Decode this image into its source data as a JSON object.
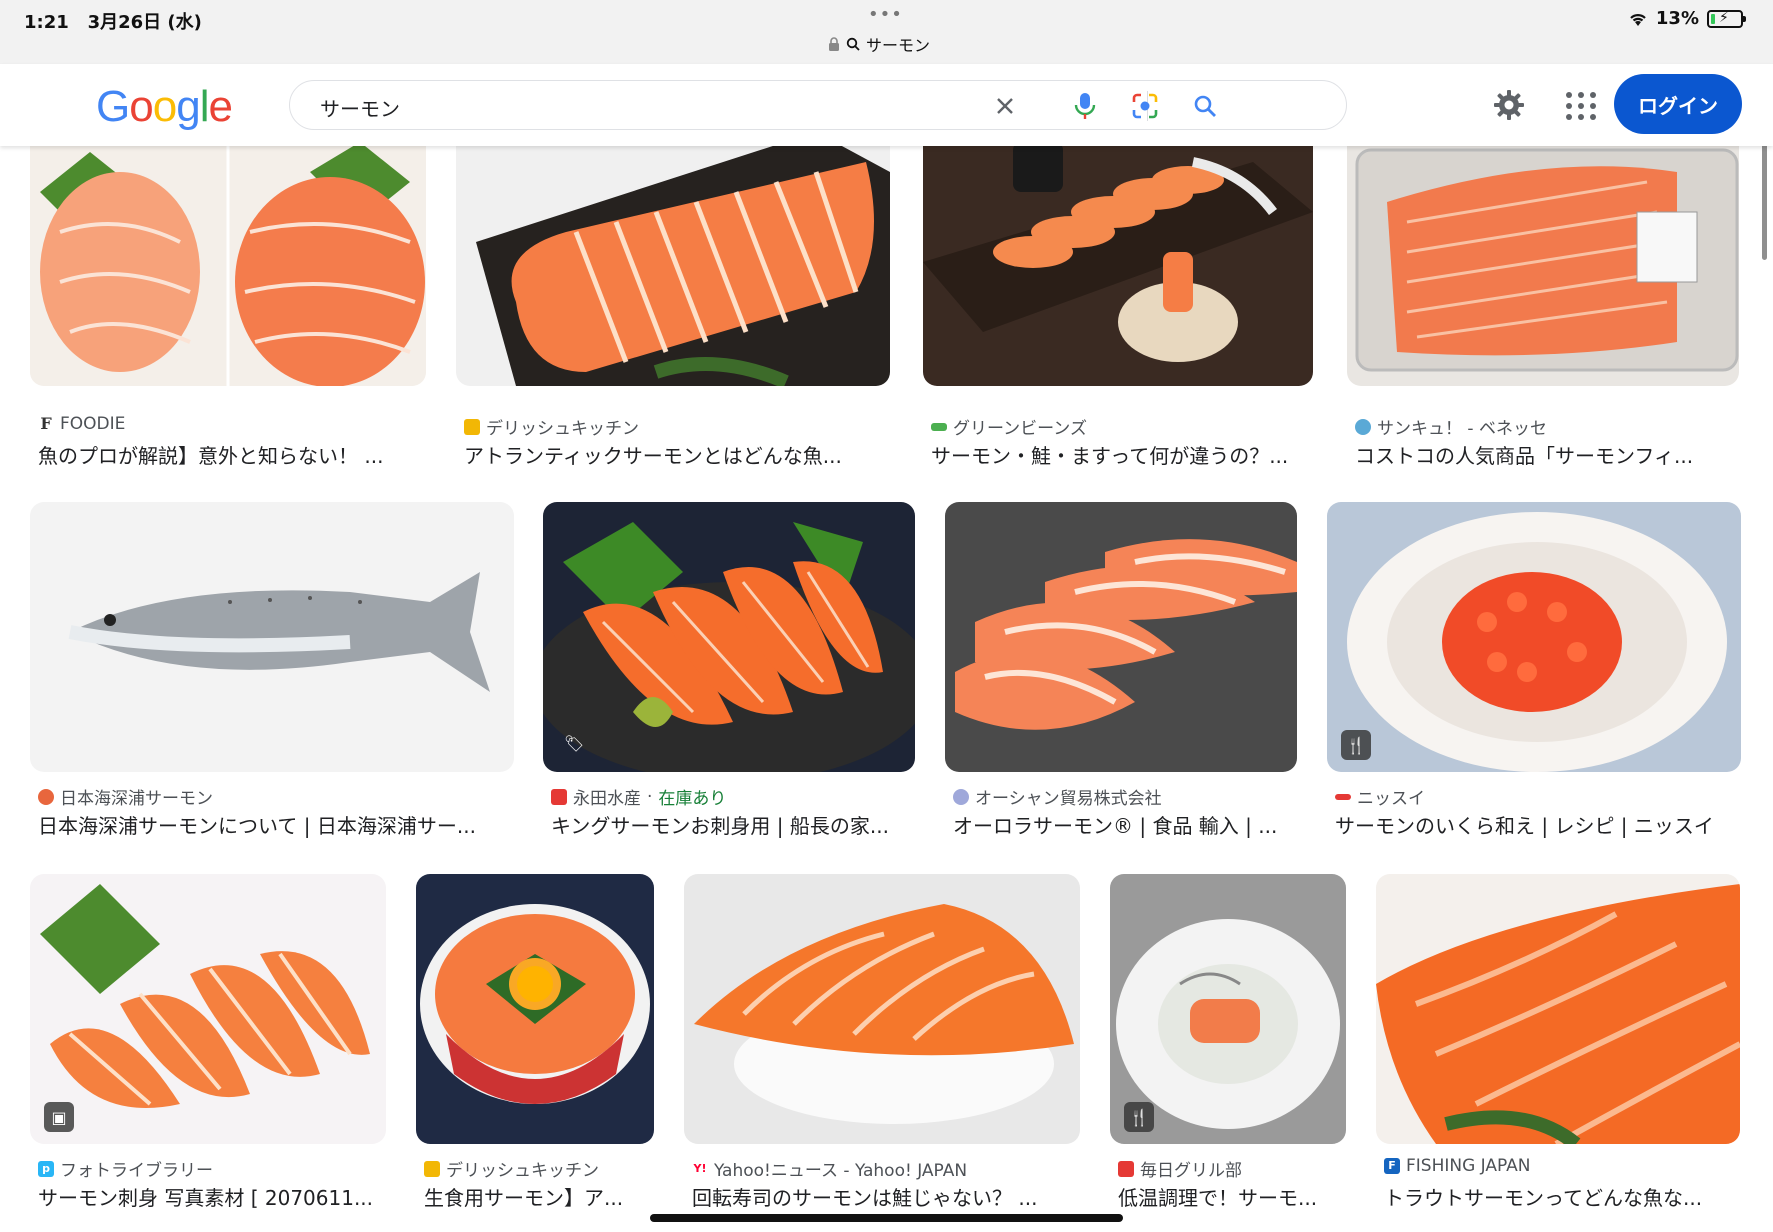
{
  "status": {
    "time": "1:21",
    "date": "3月26日 (水)",
    "dots": "•••",
    "url_text": "サーモン",
    "battery": "13%",
    "battery_level": 0.13
  },
  "header": {
    "logo": [
      "G",
      "o",
      "o",
      "g",
      "l",
      "e"
    ],
    "logo_colors": [
      "#4285F4",
      "#EA4335",
      "#FBBC05",
      "#4285F4",
      "#34A853",
      "#EA4335"
    ],
    "query": "サーモン",
    "login": "ログイン"
  },
  "results": [
    {
      "source": "FOODIE",
      "title": "魚のプロが解説】意外と知らない！ ...",
      "fav_color": "#333333",
      "fav_char": "F"
    },
    {
      "source": "デリッシュキッチン",
      "title": "アトランティックサーモンとはどんな魚...",
      "fav_color": "#f2b705",
      "fav_char": ""
    },
    {
      "source": "グリーンビーンズ",
      "title": "サーモン・鮭・ますって何が違うの？...",
      "fav_color": "#4caf50",
      "fav_char": ""
    },
    {
      "source": "サンキュ！ - ベネッセ",
      "title": "コストコの人気商品「サーモンフィ...",
      "fav_color": "#5aa9d6",
      "fav_char": ""
    },
    {
      "source": "日本海深浦サーモン",
      "title": "日本海深浦サーモンについて | 日本海深浦サー...",
      "fav_color": "#e8663d",
      "fav_char": ""
    },
    {
      "source": "永田水産",
      "source_extra": "在庫あり",
      "title": "キングサーモンお刺身用 | 船長の家...",
      "fav_color": "#e53935",
      "fav_char": ""
    },
    {
      "source": "オーシャン貿易株式会社",
      "title": "オーロラサーモン® | 食品 輸入 | ...",
      "fav_color": "#9fa8da",
      "fav_char": ""
    },
    {
      "source": "ニッスイ",
      "title": "サーモンのいくら和え | レシピ | ニッスイ",
      "fav_color": "#e53935",
      "fav_char": ""
    },
    {
      "source": "フォトライブラリー",
      "title": "サーモン刺身 写真素材 [ 2070611...",
      "fav_color": "#29b6f6",
      "fav_char": "p"
    },
    {
      "source": "デリッシュキッチン",
      "title": "生食用サーモン】ア...",
      "fav_color": "#f2b705",
      "fav_char": ""
    },
    {
      "source": "Yahoo!ニュース - Yahoo! JAPAN",
      "title": "回転寿司のサーモンは鮭じゃない？ ...",
      "fav_color": "#ff0033",
      "fav_char": "Y"
    },
    {
      "source": "毎日グリル部",
      "title": "低温調理で！サーモ...",
      "fav_color": "#e53935",
      "fav_char": ""
    },
    {
      "source": "FISHING JAPAN",
      "title": "トラウトサーモンってどんな魚な...",
      "fav_color": "#1565c0",
      "fav_char": "F"
    }
  ],
  "stock_separator": " · "
}
